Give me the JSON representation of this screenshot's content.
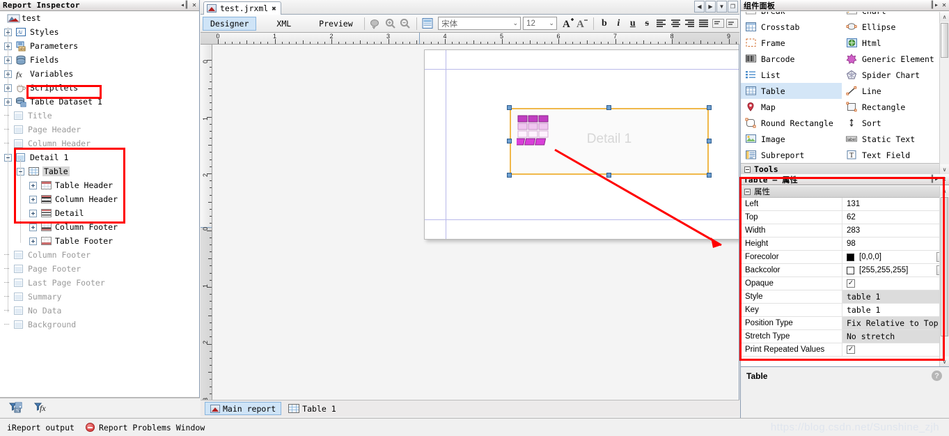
{
  "inspector": {
    "title": "Report Inspector",
    "collapse_icon": "collapse-icon",
    "close_icon": "close-icon",
    "root": "test",
    "items": [
      {
        "label": "Styles",
        "icon": "styles-icon",
        "indent": 1,
        "expander": "plus",
        "dim": false
      },
      {
        "label": "Parameters",
        "icon": "parameters-icon",
        "indent": 1,
        "expander": "plus",
        "dim": false
      },
      {
        "label": "Fields",
        "icon": "fields-icon",
        "indent": 1,
        "expander": "plus",
        "dim": false
      },
      {
        "label": "Variables",
        "icon": "variables-icon",
        "indent": 1,
        "expander": "plus",
        "dim": false
      },
      {
        "label": "Scriptlets",
        "icon": "scriptlets-icon",
        "indent": 1,
        "expander": "plus",
        "dim": false
      },
      {
        "label": "Table Dataset 1",
        "icon": "dataset-icon",
        "indent": 1,
        "expander": "plus",
        "dim": false
      },
      {
        "label": "Title",
        "icon": "band-icon",
        "indent": 1,
        "expander": "none",
        "dim": true
      },
      {
        "label": "Page Header",
        "icon": "band-icon",
        "indent": 1,
        "expander": "none",
        "dim": true
      },
      {
        "label": "Column Header",
        "icon": "band-icon",
        "indent": 1,
        "expander": "none",
        "dim": true
      },
      {
        "label": "Detail 1",
        "icon": "band-icon",
        "indent": 1,
        "expander": "minus",
        "dim": false
      },
      {
        "label": "Table",
        "icon": "table-icon",
        "indent": 2,
        "expander": "minus",
        "dim": false,
        "selected": true
      },
      {
        "label": "Table Header",
        "icon": "table-header-icon",
        "indent": 3,
        "expander": "plus",
        "dim": false
      },
      {
        "label": "Column Header",
        "icon": "column-header-icon",
        "indent": 3,
        "expander": "plus",
        "dim": false
      },
      {
        "label": "Detail",
        "icon": "detail-icon",
        "indent": 3,
        "expander": "plus",
        "dim": false
      },
      {
        "label": "Column Footer",
        "icon": "column-footer-icon",
        "indent": 3,
        "expander": "plus",
        "dim": false
      },
      {
        "label": "Table Footer",
        "icon": "table-footer-icon",
        "indent": 3,
        "expander": "plus",
        "dim": false
      },
      {
        "label": "Column Footer",
        "icon": "band-icon",
        "indent": 1,
        "expander": "none",
        "dim": true
      },
      {
        "label": "Page Footer",
        "icon": "band-icon",
        "indent": 1,
        "expander": "none",
        "dim": true
      },
      {
        "label": "Last Page Footer",
        "icon": "band-icon",
        "indent": 1,
        "expander": "none",
        "dim": true
      },
      {
        "label": "Summary",
        "icon": "band-icon",
        "indent": 1,
        "expander": "none",
        "dim": true
      },
      {
        "label": "No Data",
        "icon": "band-icon",
        "indent": 1,
        "expander": "none",
        "dim": true
      },
      {
        "label": "Background",
        "icon": "band-icon",
        "indent": 1,
        "expander": "none",
        "dim": true
      }
    ],
    "tools": [
      {
        "icon": "filter-dataset-icon"
      },
      {
        "icon": "filter-expression-icon"
      }
    ]
  },
  "editor": {
    "tab": {
      "label": "test.jrxml",
      "close": "✖",
      "icon": "jrxml-file-icon"
    },
    "nav": {
      "prev": "◀",
      "next": "▶",
      "dropdown": "▼",
      "restore": "❐"
    },
    "views": [
      {
        "label": "Designer",
        "active": true
      },
      {
        "label": "XML",
        "active": false
      },
      {
        "label": "Preview",
        "active": false
      }
    ],
    "toolbar_icons": [
      "zoom-fit-icon",
      "zoom-in-icon",
      "zoom-out-icon",
      "report-properties-icon"
    ],
    "font_family": {
      "value": "宋体",
      "arrow": "⌄"
    },
    "font_size": {
      "value": "12",
      "arrow": "⌄"
    },
    "format_buttons": [
      {
        "label": "A",
        "name": "increase-font-size-button"
      },
      {
        "label": "A",
        "name": "decrease-font-size-button"
      },
      {
        "label": "b",
        "name": "bold-button"
      },
      {
        "label": "i",
        "name": "italic-button"
      },
      {
        "label": "u",
        "name": "underline-button"
      },
      {
        "label": "s",
        "name": "strikethrough-button"
      },
      {
        "label": "≡",
        "name": "align-left-button"
      },
      {
        "label": "≡",
        "name": "align-center-button"
      },
      {
        "label": "≡",
        "name": "align-right-button"
      },
      {
        "label": "≡",
        "name": "align-justify-button"
      },
      {
        "label": "▤",
        "name": "valign-top-button"
      },
      {
        "label": "▤",
        "name": "valign-middle-button"
      }
    ],
    "ruler_h_labels": [
      "0",
      "1",
      "2",
      "3",
      "4",
      "5",
      "6",
      "7",
      "8",
      "9"
    ],
    "ruler_v_labels": [
      "0",
      "1",
      "2",
      "0",
      "1",
      "2",
      "3"
    ],
    "canvas": {
      "band_label": "Detail 1",
      "element_icon": "table-element-icon",
      "selection_color": "#f0b84a",
      "highlight_color": "#ff0000"
    },
    "bottom_tabs": [
      {
        "label": "Main report",
        "icon": "main-report-icon",
        "active": true
      },
      {
        "label": "Table 1",
        "icon": "table-tab-icon",
        "active": false
      }
    ]
  },
  "palette": {
    "title": "组件面板",
    "collapse_icon": "expand-icon",
    "close_icon": "close-icon",
    "items_left": [
      {
        "label": "Break",
        "icon": "break-icon",
        "clipped": true
      },
      {
        "label": "Crosstab",
        "icon": "crosstab-icon"
      },
      {
        "label": "Frame",
        "icon": "frame-icon"
      },
      {
        "label": "Barcode",
        "icon": "barcode-icon"
      },
      {
        "label": "List",
        "icon": "list-icon"
      },
      {
        "label": "Table",
        "icon": "table-icon",
        "selected": true
      },
      {
        "label": "Map",
        "icon": "map-icon"
      },
      {
        "label": "Round Rectangle",
        "icon": "round-rectangle-icon"
      },
      {
        "label": "Image",
        "icon": "image-icon"
      },
      {
        "label": "Subreport",
        "icon": "subreport-icon"
      }
    ],
    "items_right": [
      {
        "label": "Chart",
        "icon": "chart-icon",
        "clipped": true
      },
      {
        "label": "Ellipse",
        "icon": "ellipse-icon"
      },
      {
        "label": "Html",
        "icon": "html-icon"
      },
      {
        "label": "Generic Element",
        "icon": "generic-element-icon"
      },
      {
        "label": "Spider Chart",
        "icon": "spider-chart-icon"
      },
      {
        "label": "Line",
        "icon": "line-icon"
      },
      {
        "label": "Rectangle",
        "icon": "rectangle-icon"
      },
      {
        "label": "Sort",
        "icon": "sort-icon"
      },
      {
        "label": "Static Text",
        "icon": "static-text-icon"
      },
      {
        "label": "Text Field",
        "icon": "text-field-icon"
      }
    ],
    "section": "Tools",
    "scroll": {
      "up": "∧",
      "down": "∨"
    }
  },
  "properties": {
    "title": "Table — 属性",
    "collapse_icon": "expand-icon",
    "close_icon": "close-icon",
    "group": "属性",
    "rows": [
      {
        "name": "Left",
        "value": "131",
        "type": "text"
      },
      {
        "name": "Top",
        "value": "62",
        "type": "text"
      },
      {
        "name": "Width",
        "value": "283",
        "type": "text"
      },
      {
        "name": "Height",
        "value": "98",
        "type": "text"
      },
      {
        "name": "Forecolor",
        "value": "[0,0,0]",
        "type": "color",
        "swatch": "#000000",
        "ellipsis": "..."
      },
      {
        "name": "Backcolor",
        "value": "[255,255,255]",
        "type": "color",
        "swatch": "#ffffff",
        "ellipsis": "..."
      },
      {
        "name": "Opaque",
        "value": "",
        "type": "checkbox",
        "checked": true
      },
      {
        "name": "Style",
        "value": "table 1",
        "type": "dropdown"
      },
      {
        "name": "Key",
        "value": "table 1",
        "type": "mono"
      },
      {
        "name": "Position Type",
        "value": "Fix Relative to Top",
        "type": "dropdown"
      },
      {
        "name": "Stretch Type",
        "value": "No stretch",
        "type": "dropdown"
      },
      {
        "name": "Print Repeated Values",
        "value": "",
        "type": "checkbox",
        "checked": true
      }
    ],
    "description": "Table",
    "help_icon": "?"
  },
  "status": {
    "output_label": "iReport output",
    "problems_label": "Report Problems Window",
    "problems_icon": "error-icon"
  },
  "watermark": "https://blog.csdn.net/Sunshine_zjh",
  "colors": {
    "selection_orange": "#f0b84a",
    "highlight_red": "#ff0000",
    "tab_blue": "#cfe4f7",
    "panel_bg": "#f0f0f0"
  }
}
